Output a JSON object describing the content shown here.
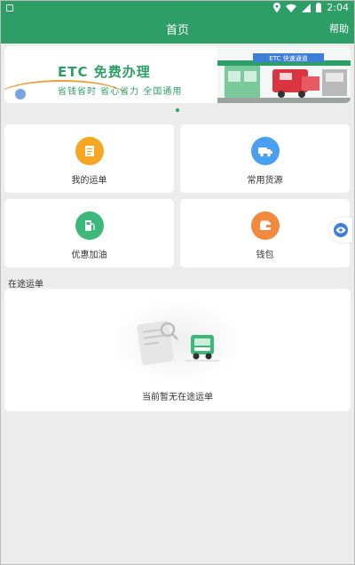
{
  "status_bar": {
    "time": "2:04"
  },
  "header": {
    "title": "首页",
    "help_label": "帮助"
  },
  "banner": {
    "title": "ETC 免费办理",
    "subtitle": "省钱省时 省心省力 全国通用",
    "sign_text": "ETC 快速通道",
    "slide_count": 1,
    "active_slide": 1
  },
  "grid": [
    {
      "label": "我的运单",
      "icon": "waybill-icon",
      "color": "#f5a623"
    },
    {
      "label": "常用货源",
      "icon": "truck-icon",
      "color": "#4a9ff0"
    },
    {
      "label": "优惠加油",
      "icon": "fuel-pump-icon",
      "color": "#3db87a"
    },
    {
      "label": "钱包",
      "icon": "wallet-icon",
      "color": "#f08a3e"
    }
  ],
  "in_transit": {
    "section_title": "在途运单",
    "empty_text": "当前暂无在途运单"
  },
  "colors": {
    "primary": "#2e9e67",
    "background": "#ececec"
  }
}
